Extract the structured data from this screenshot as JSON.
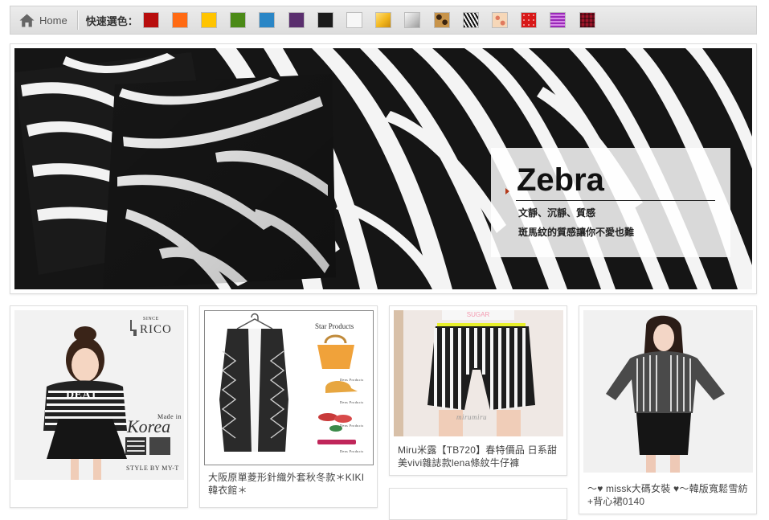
{
  "toolbar": {
    "home_label": "Home",
    "quick_select_label": "快速選色：",
    "home_icon": "home-icon",
    "swatches": [
      {
        "name": "red",
        "color": "#b80d0d"
      },
      {
        "name": "orange",
        "color": "#ff6a13"
      },
      {
        "name": "yellow",
        "color": "#ffc400"
      },
      {
        "name": "green",
        "color": "#4b8a17"
      },
      {
        "name": "blue",
        "color": "#2a86c6"
      },
      {
        "name": "purple",
        "color": "#5a2e6e"
      },
      {
        "name": "black",
        "color": "#1b1b1b"
      },
      {
        "name": "white",
        "color": "#f7f7f7"
      },
      {
        "name": "gold",
        "color": "#f2b61c"
      },
      {
        "name": "silver",
        "color": "#cfcfcf"
      },
      {
        "name": "leopard",
        "color": "#a8763a"
      },
      {
        "name": "zebra",
        "color": "#222222"
      },
      {
        "name": "floral",
        "color": "#f2c7a0"
      },
      {
        "name": "polka-dot",
        "color": "#d81818"
      },
      {
        "name": "stripe",
        "color": "#9a2ab8"
      },
      {
        "name": "plaid",
        "color": "#8a1a2a"
      }
    ]
  },
  "banner": {
    "title": "Zebra",
    "subtitle": "文靜、沉靜、質感",
    "tagline": "斑馬紋的質感讓你不愛也難",
    "accent_color": "#b33a1a"
  },
  "products": [
    {
      "title": "",
      "logo": "RICO",
      "logo_small": "SINCE",
      "overlay_made_in": "Made in",
      "overlay_country": "Korea",
      "overlay_store": "STYLE BY MY-T",
      "shirt_text": "DEAT"
    },
    {
      "title": "大阪原單菱形針織外套秋冬款＊KIKI韓衣館＊",
      "header_text": "Star Products",
      "mini_labels": [
        "Dens Products",
        "Dens Products",
        "Dens Products",
        "Dens Products"
      ]
    },
    {
      "title": "Miru米露【TB720】春特價品 日系甜美vivi雜誌款lena條紋牛仔褲",
      "watermark": "mirumiru"
    },
    {
      "title": "～♥ missk大碼女裝 ♥～韓版寬鬆雪紡+背心裙0140"
    }
  ]
}
